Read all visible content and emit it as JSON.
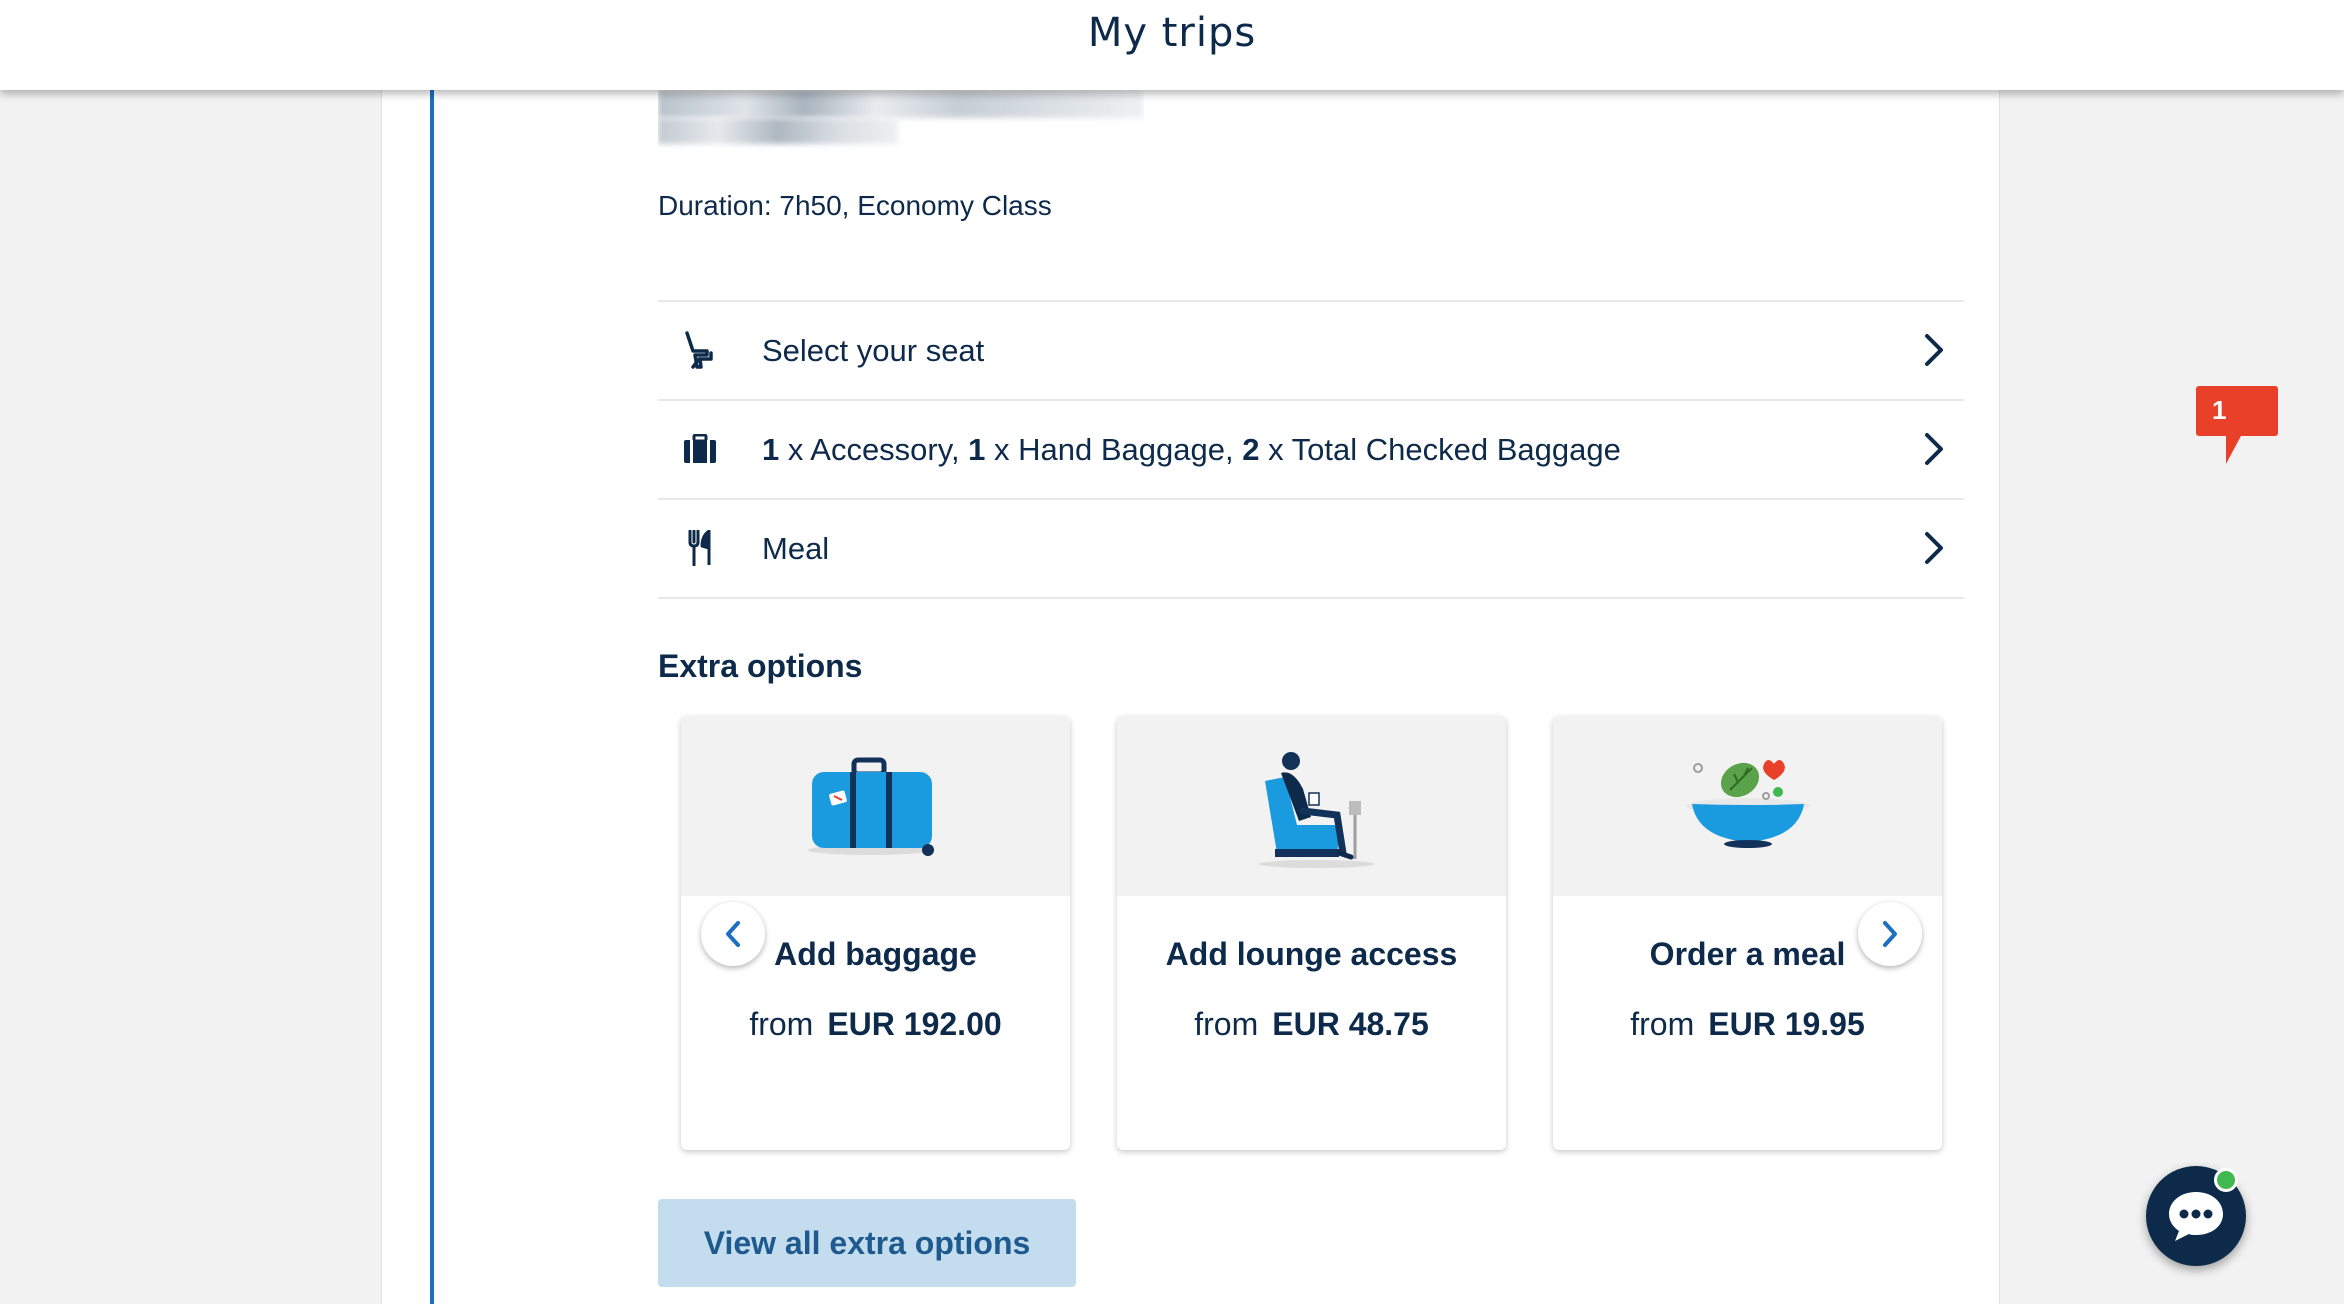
{
  "header": {
    "title": "My trips"
  },
  "flight": {
    "duration_text": "Duration: 7h50, Economy Class"
  },
  "options": {
    "seat": {
      "label": "Select your seat"
    },
    "baggage": {
      "accessory_count": "1",
      "accessory_text": " x Accessory, ",
      "hand_count": "1",
      "hand_text": " x Hand Baggage, ",
      "checked_count": "2",
      "checked_text": " x Total Checked Baggage"
    },
    "meal": {
      "label": "Meal"
    }
  },
  "extra_options": {
    "title": "Extra options",
    "cards": [
      {
        "title": "Add baggage",
        "from": "from",
        "price": "EUR 192.00",
        "icon": "suitcase-illustration"
      },
      {
        "title": "Add lounge access",
        "from": "from",
        "price": "EUR 48.75",
        "icon": "lounge-illustration"
      },
      {
        "title": "Order a meal",
        "from": "from",
        "price": "EUR 19.95",
        "icon": "meal-bowl-illustration"
      }
    ],
    "view_all_label": "View all extra options"
  },
  "notification": {
    "count": "1"
  },
  "colors": {
    "accent": "#1d6fc1",
    "navy": "#0e2a4a",
    "button_bg": "#c3dcee",
    "badge": "#e9402a"
  }
}
